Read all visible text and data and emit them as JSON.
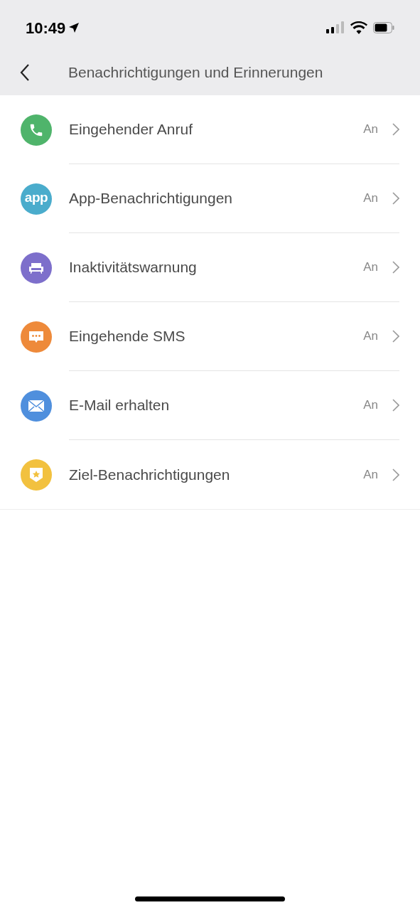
{
  "status_bar": {
    "time": "10:49"
  },
  "header": {
    "title": "Benachrichtigungen und Erinnerungen"
  },
  "items": [
    {
      "kind": "phone",
      "color": "#4fb46b",
      "label": "Eingehender Anruf",
      "value": "An"
    },
    {
      "kind": "app",
      "color": "#4aaccc",
      "icon_text": "app",
      "label": "App-Benachrichtigungen",
      "value": "An"
    },
    {
      "kind": "sofa",
      "color": "#7d6fcb",
      "label": "Inaktivitätswarnung",
      "value": "An"
    },
    {
      "kind": "sms",
      "color": "#ee8a3a",
      "label": "Eingehende SMS",
      "value": "An"
    },
    {
      "kind": "mail",
      "color": "#4f8fdd",
      "label": "E-Mail erhalten",
      "value": "An"
    },
    {
      "kind": "goal",
      "color": "#f2c13f",
      "label": "Ziel-Benachrichtigungen",
      "value": "An"
    }
  ]
}
